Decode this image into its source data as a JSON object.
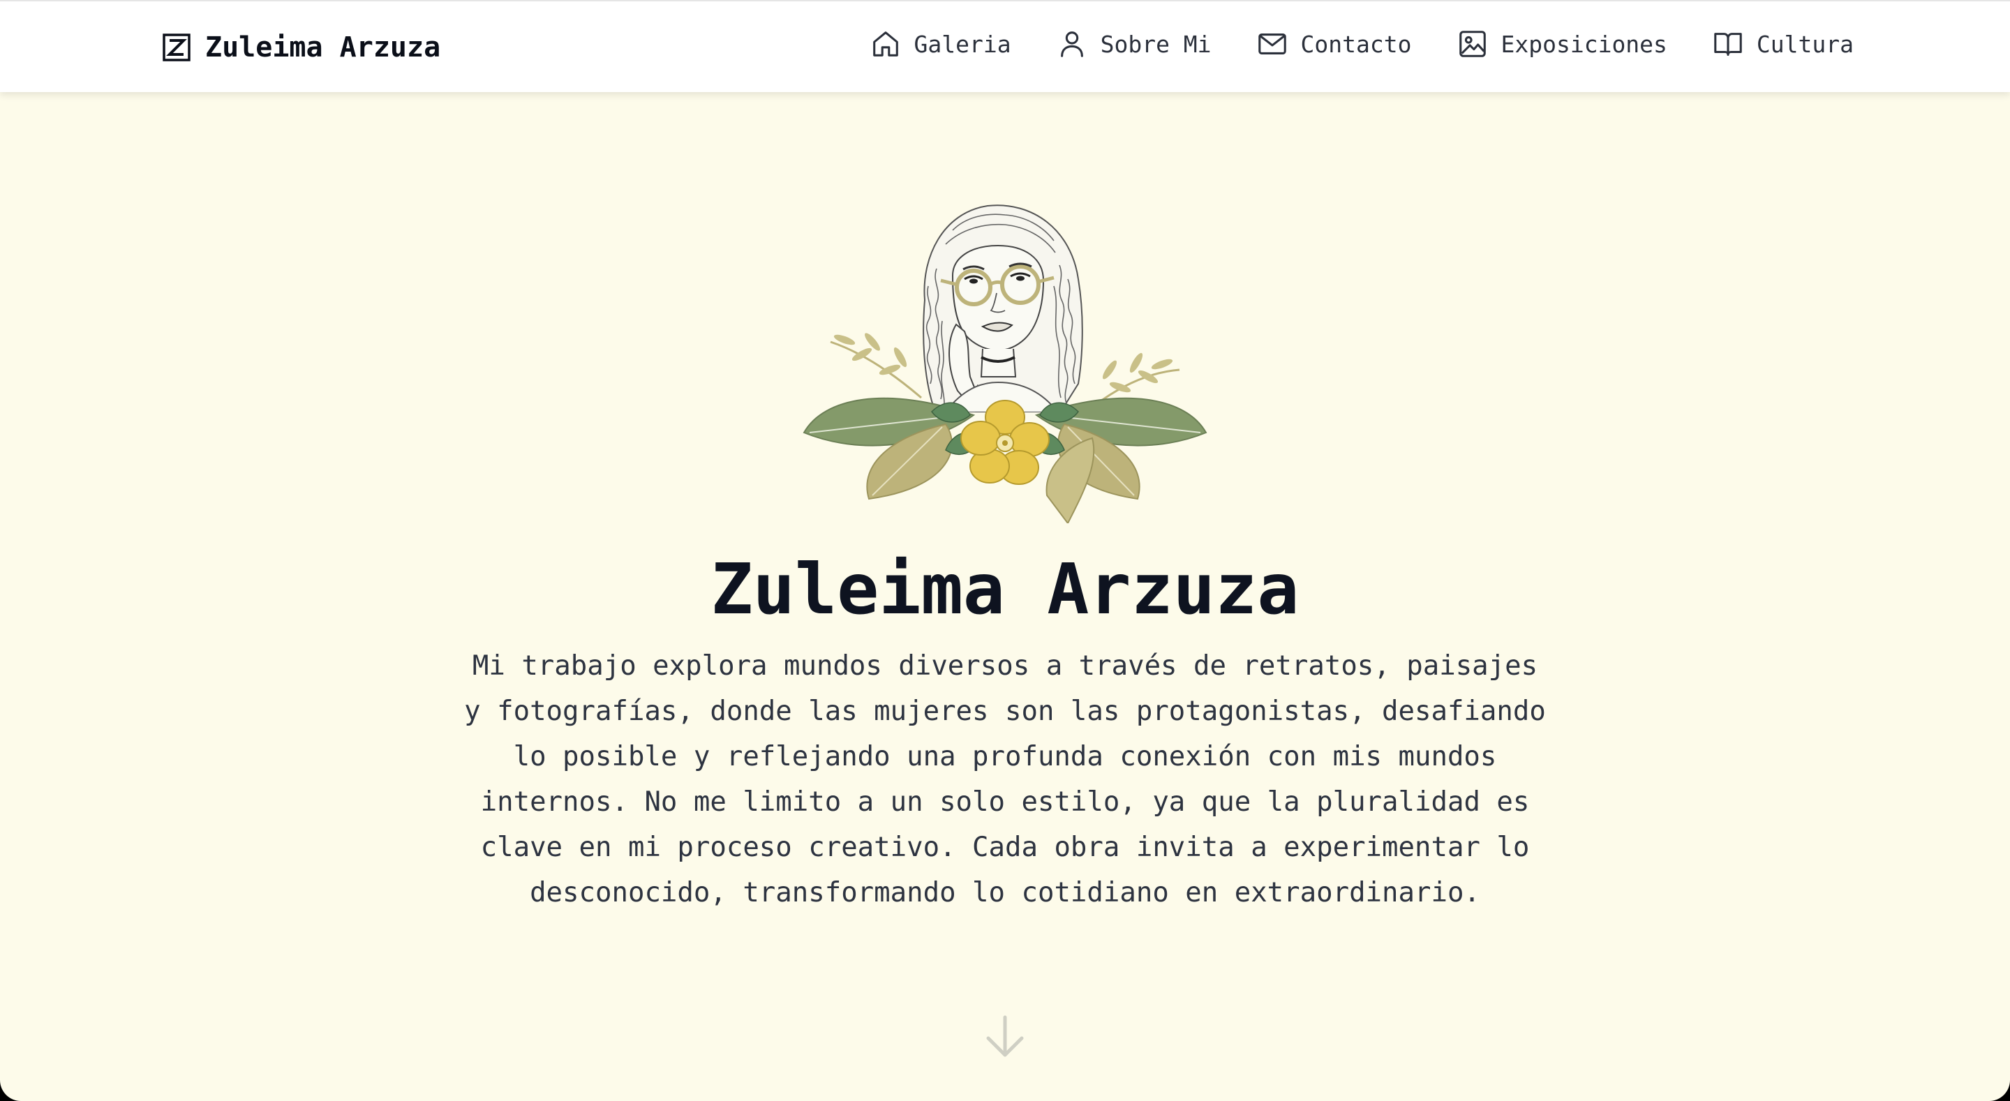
{
  "header": {
    "brand_icon": "z-logo-icon",
    "brand_name": "Zuleima Arzuza",
    "nav": [
      {
        "label": "Galeria",
        "icon": "home-icon"
      },
      {
        "label": "Sobre Mi",
        "icon": "user-icon"
      },
      {
        "label": "Contacto",
        "icon": "mail-icon"
      },
      {
        "label": "Exposiciones",
        "icon": "image-icon"
      },
      {
        "label": "Cultura",
        "icon": "book-icon"
      }
    ]
  },
  "hero": {
    "portrait_icon": "artist-portrait-illustration",
    "title": "Zuleima Arzuza",
    "description": "Mi trabajo explora mundos diversos a través de retratos, paisajes y fotografías, donde las mujeres son las protagonistas, desafiando lo posible y reflejando una profunda conexión con mis mundos internos. No me limito a un solo estilo, ya que la pluralidad es clave en mi proceso creativo. Cada obra invita a experimentar lo desconocido, transformando lo cotidiano en extraordinario.",
    "scroll_icon": "arrow-down-icon"
  },
  "colors": {
    "background": "#fdfbea",
    "header_bg": "#ffffff",
    "text_dark": "#0e1320",
    "text_body": "#2d3340",
    "leaf_green": "#849a6a",
    "leaf_olive": "#bdb37a",
    "flower_yellow": "#e7c64a"
  }
}
